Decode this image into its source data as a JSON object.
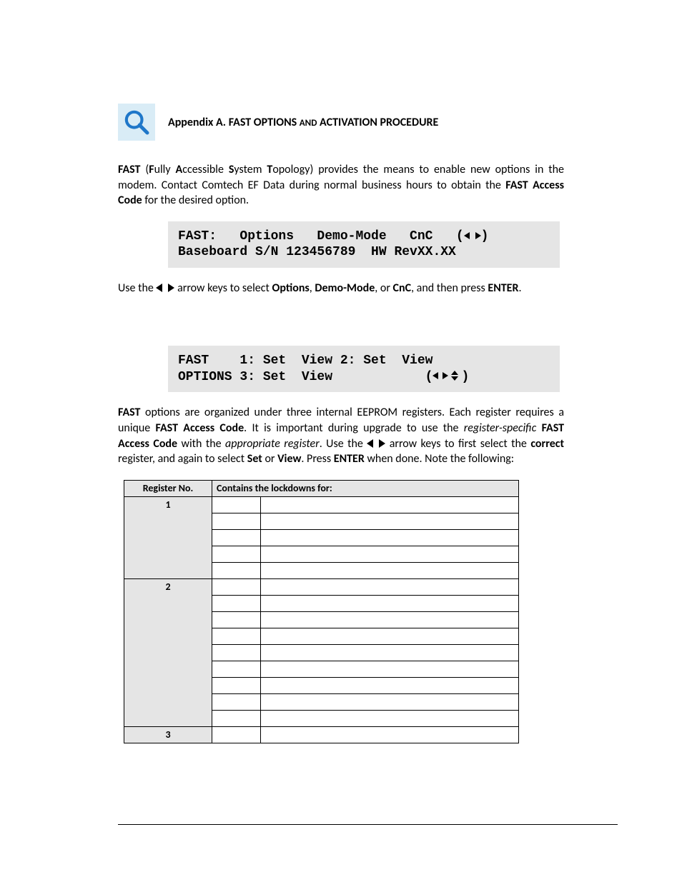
{
  "header": {
    "title_prefix": "Appendix A. FAST OPTIONS ",
    "title_small": "AND",
    "title_suffix": " ACTIVATION PROCEDURE"
  },
  "para1": {
    "t1": "FAST",
    "t2": " (",
    "t3": "F",
    "t4": "ully ",
    "t5": "A",
    "t6": "ccessible ",
    "t7": "S",
    "t8": "ystem ",
    "t9": "T",
    "t10": "opology) provides the means to enable new options in the modem. Contact Comtech EF Data during normal business hours to obtain the ",
    "t11": "FAST Access Code",
    "t12": " for the desired option."
  },
  "lcd1": {
    "line1_a": "FAST:   Options   Demo-Mode   CnC   (",
    "line1_b": ")",
    "line2": "Baseboard S/N 123456789  HW RevXX.XX"
  },
  "para2": {
    "t1": "Use the ",
    "t2": " arrow keys to select ",
    "t3": "Options",
    "t4": ", ",
    "t5": "Demo-Mode",
    "t6": ", or ",
    "t7": "CnC",
    "t8": ", and then press ",
    "t9": "ENTER",
    "t10": "."
  },
  "lcd2": {
    "line1": "FAST    1: Set  View 2: Set  View",
    "line2_a": "OPTIONS 3: Set  View            (",
    "line2_b": ")"
  },
  "para3": {
    "t1": "FAST",
    "t2": " options are organized under three internal EEPROM registers. Each register requires a unique ",
    "t3": "FAST Access Code",
    "t4": ". It is important during upgrade to use the ",
    "t5": "register-specific",
    "t6": " ",
    "t7": "FAST Access Code",
    "t8": " with the ",
    "t9": "appropriate register",
    "t10": ". Use the ",
    "t11": " arrow keys to first select the ",
    "t12": "correct",
    "t13": " register, and again to select ",
    "t14": "Set",
    "t15": " or ",
    "t16": "View",
    "t17": ". Press ",
    "t18": "ENTER",
    "t19": " when done. Note the following:"
  },
  "table": {
    "h1": "Register No.",
    "h2": "Contains the lockdowns for:",
    "r1": "1",
    "r2": "2",
    "r3": "3"
  }
}
